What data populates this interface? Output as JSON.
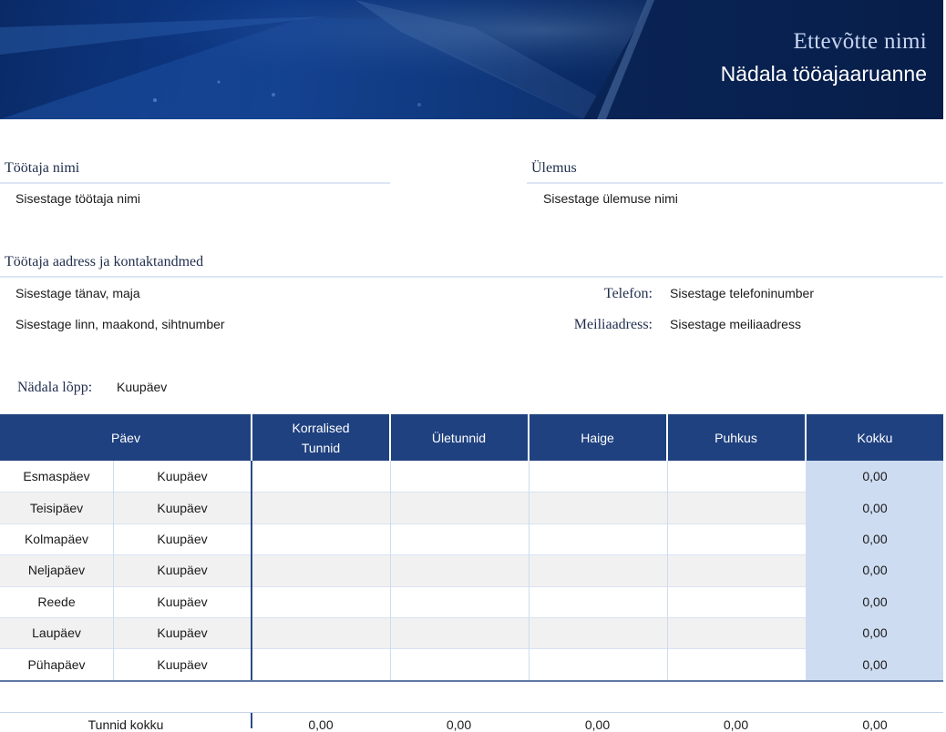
{
  "header": {
    "company": "Ettevõtte nimi",
    "title": "Nädala tööajaaruanne"
  },
  "employee": {
    "name_label": "Töötaja nimi",
    "name_value": "Sisestage töötaja nimi",
    "manager_label": "Ülemus",
    "manager_value": "Sisestage ülemuse nimi",
    "address_label": "Töötaja aadress ja kontaktandmed",
    "street_value": "Sisestage tänav, maja",
    "city_value": "Sisestage linn, maakond, sihtnumber",
    "phone_label": "Telefon:",
    "phone_value": "Sisestage telefoninumber",
    "email_label": "Meiliaadress:",
    "email_value": "Sisestage meiliaadress"
  },
  "week": {
    "label": "Nädala lõpp:",
    "value": "Kuupäev"
  },
  "table": {
    "headers": {
      "day": "Päev",
      "regular": "Korralised Tunnid",
      "overtime": "Ületunnid",
      "sick": "Haige",
      "vacation": "Puhkus",
      "total": "Kokku"
    },
    "rows": [
      {
        "day": "Esmaspäev",
        "date": "Kuupäev",
        "total": "0,00"
      },
      {
        "day": "Teisipäev",
        "date": "Kuupäev",
        "total": "0,00"
      },
      {
        "day": "Kolmapäev",
        "date": "Kuupäev",
        "total": "0,00"
      },
      {
        "day": "Neljapäev",
        "date": "Kuupäev",
        "total": "0,00"
      },
      {
        "day": "Reede",
        "date": "Kuupäev",
        "total": "0,00"
      },
      {
        "day": "Laupäev",
        "date": "Kuupäev",
        "total": "0,00"
      },
      {
        "day": "Pühapäev",
        "date": "Kuupäev",
        "total": "0,00"
      }
    ],
    "summary": {
      "label": "Tunnid kokku",
      "regular": "0,00",
      "overtime": "0,00",
      "sick": "0,00",
      "vacation": "0,00",
      "total": "0,00"
    }
  }
}
